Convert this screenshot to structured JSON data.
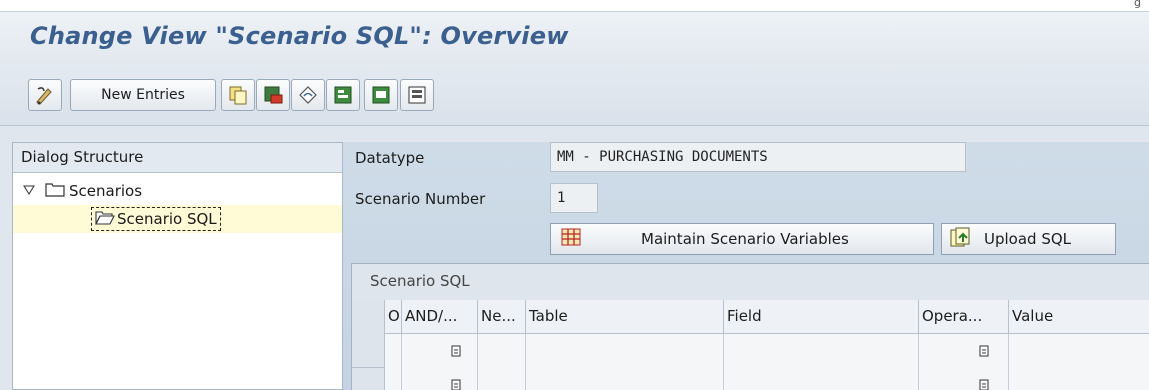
{
  "window": {
    "top_right_fragment": "g"
  },
  "header": {
    "title": "Change View \"Scenario SQL\": Overview"
  },
  "toolbar": {
    "new_entries_label": "New Entries",
    "icons": [
      "display-change-icon",
      "copy-as-icon",
      "delete-icon",
      "undo-change-icon",
      "select-all-icon",
      "select-block-icon",
      "deselect-all-icon"
    ]
  },
  "dialog_structure": {
    "header": "Dialog Structure",
    "items": [
      {
        "label": "Scenarios",
        "expanded": true,
        "level": 0
      },
      {
        "label": "Scenario SQL",
        "selected": true,
        "level": 1
      }
    ]
  },
  "detail": {
    "datatype_label": "Datatype",
    "datatype_value": "MM - PURCHASING DOCUMENTS",
    "scenario_number_label": "Scenario Number",
    "scenario_number_value": "1",
    "maintain_button_label": "Maintain Scenario Variables",
    "upload_button_label": "Upload SQL"
  },
  "table": {
    "title": "Scenario SQL",
    "columns": [
      "O",
      "AND/...",
      "Ne...",
      "Table",
      "Field",
      "Opera...",
      "Value"
    ]
  },
  "colors": {
    "title_text": "#3b5f8e",
    "selection_bg": "#fffbd6",
    "content_bg": "#c9d7e5"
  }
}
